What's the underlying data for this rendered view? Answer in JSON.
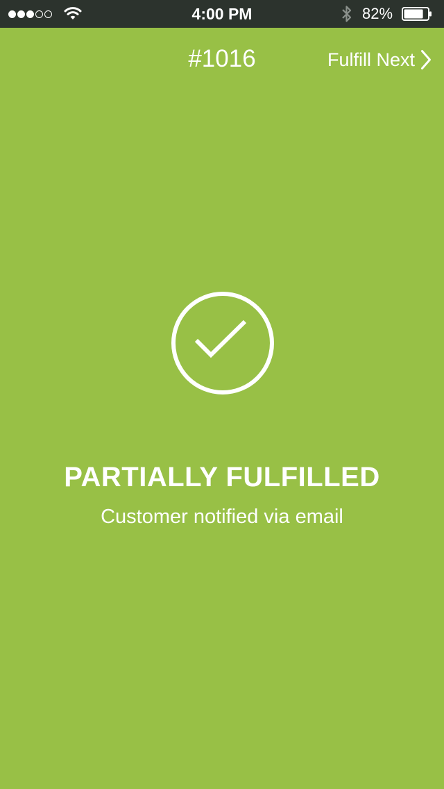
{
  "status_bar": {
    "signal_bars_filled": 3,
    "signal_bars_total": 5,
    "time": "4:00 PM",
    "battery_percent_label": "82%",
    "battery_level": 0.82,
    "icons": [
      "signal-dots",
      "wifi-icon",
      "bluetooth-icon",
      "battery-icon"
    ]
  },
  "nav": {
    "order_number": "#1016",
    "fulfill_next_label": "Fulfill Next",
    "fulfill_next_icon": "chevron-right-icon"
  },
  "result": {
    "icon": "checkmark-circle-icon",
    "title": "PARTIALLY FULFILLED",
    "subtitle": "Customer notified via email"
  },
  "colors": {
    "background": "#98c046",
    "status_bar": "#2c332d",
    "foreground": "#ffffff"
  }
}
